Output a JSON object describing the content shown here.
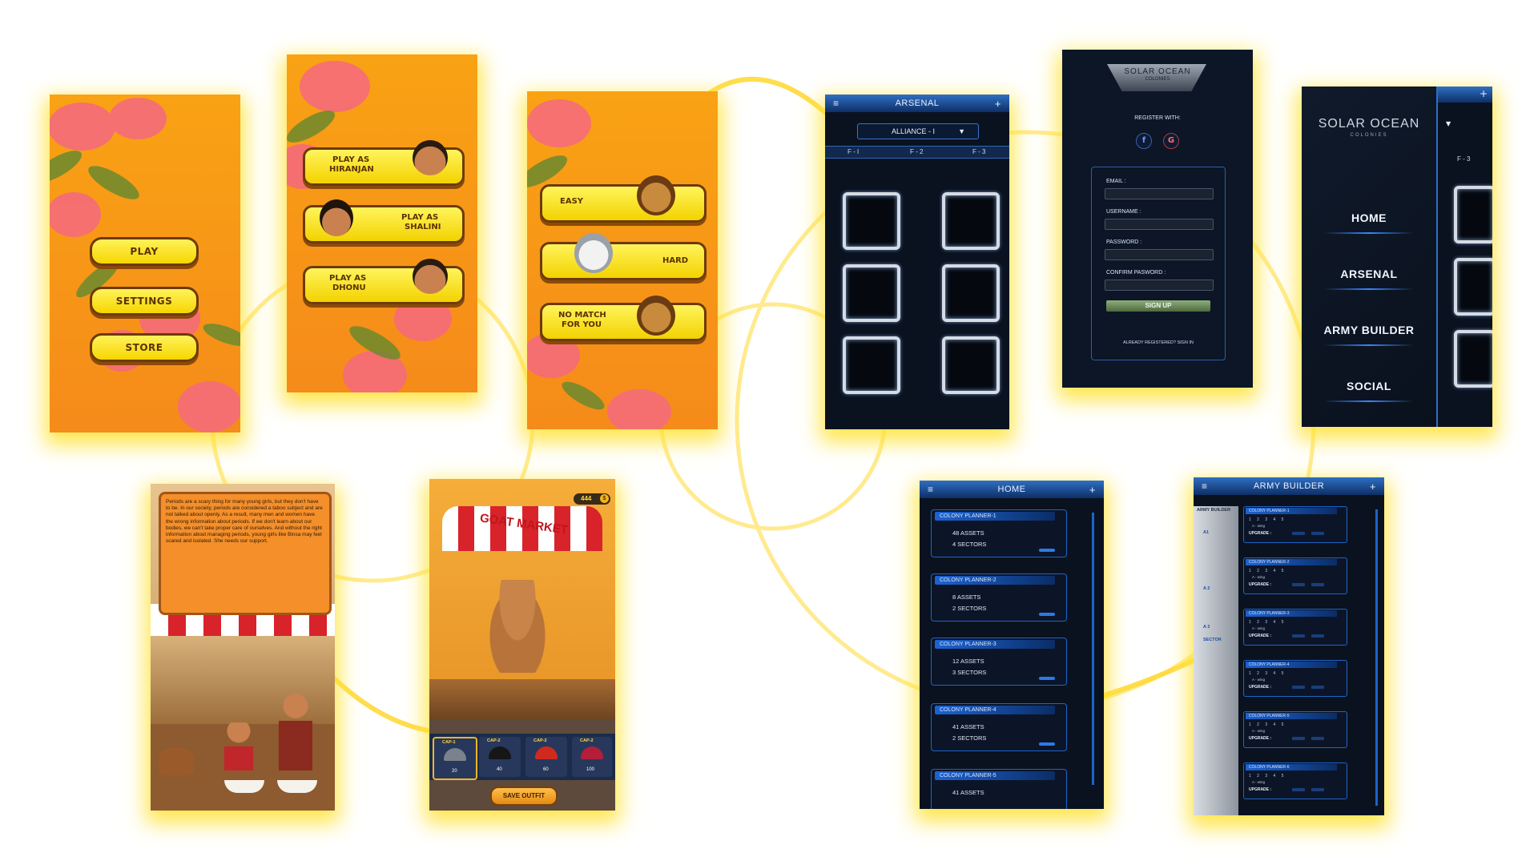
{
  "colors": {
    "accent_yellow": "#ffe230",
    "orange_bg": "#f79a17",
    "dark_bg": "#0a1220",
    "blue_bar": "#1f5fc0"
  },
  "screen_a": {
    "buttons": [
      {
        "label": "PLAY"
      },
      {
        "label": "SETTINGS"
      },
      {
        "label": "STORE"
      }
    ]
  },
  "screen_b": {
    "players": [
      {
        "line1": "PLAY AS",
        "line2": "HIRANJAN"
      },
      {
        "line1": "PLAY AS",
        "line2": "SHALINI"
      },
      {
        "line1": "PLAY AS",
        "line2": "DHONU"
      }
    ]
  },
  "screen_c": {
    "options": [
      {
        "line1": "EASY",
        "line2": ""
      },
      {
        "line1": "HARD",
        "line2": ""
      },
      {
        "line1": "NO MATCH",
        "line2": "FOR YOU"
      }
    ]
  },
  "arsenal": {
    "title": "ARSENAL",
    "menu_icon": "hamburger-icon",
    "add_icon": "plus-icon",
    "dropdown": "ALLIANCE - I",
    "tabs": [
      "F - I",
      "F - 2",
      "F - 3"
    ]
  },
  "register": {
    "logo_text": "SOLAR OCEAN",
    "logo_sub": "COLONIES",
    "register_with": "REGISTER WITH:",
    "facebook": "f",
    "google": "G",
    "email_label": "EMAIL :",
    "username_label": "USERNAME :",
    "password_label": "PASSWORD :",
    "confirm_label": "CONFIRM PASWORD :",
    "signup": "SIGN UP",
    "signin": "ALREADY REGISTERED? SIGN IN"
  },
  "menu_screen": {
    "logo_text": "SOLAR OCEAN",
    "logo_sub": "COLONIES",
    "items": [
      "HOME",
      "ARSENAL",
      "ARMY BUILDER",
      "SOCIAL"
    ],
    "peek_tab": "F - 3"
  },
  "story": {
    "text": "Periods are a scary thing for many young girls, but they don't have to be. In our society, periods are considered a taboo subject and are not talked about openly. As a result, many men and women have the wrong information about periods. If we don't learn about our bodies, we can't take proper care of ourselves. And without the right information about managing periods, young girls like Binsa may feel scared and isolated. She needs our support."
  },
  "market": {
    "coins": "444",
    "coin_symbol": "$",
    "sign": "GOAT MARKET",
    "caps": [
      {
        "name": "CAP-1",
        "price": "20"
      },
      {
        "name": "CAP-2",
        "price": "40"
      },
      {
        "name": "CAP-2",
        "price": "60"
      },
      {
        "name": "CAP-2",
        "price": "100"
      }
    ],
    "save": "SAVE OUTFIT"
  },
  "home": {
    "title": "HOME",
    "planners": [
      {
        "name": "COLONY PLANNER-1",
        "assets": "48 ASSETS",
        "sectors": "4 SECTORS"
      },
      {
        "name": "COLONY PLANNER-2",
        "assets": "8 ASSETS",
        "sectors": "2 SECTORS"
      },
      {
        "name": "COLONY PLANNER-3",
        "assets": "12 ASSETS",
        "sectors": "3 SECTORS"
      },
      {
        "name": "COLONY PLANNER-4",
        "assets": "41 ASSETS",
        "sectors": "2 SECTORS"
      },
      {
        "name": "COLONY PLANNER-5",
        "assets": "41 ASSETS",
        "sectors": ""
      }
    ]
  },
  "army": {
    "title": "ARMY BUILDER",
    "side_title": "ARMY BUILDER",
    "side_items": [
      "A1",
      "A 2",
      "A 3",
      "SECTOR"
    ],
    "rows": [
      "COLONY PLANNER-1",
      "COLONY PLANNER-2",
      "COLONY PLANNER-3",
      "COLONY PLANNER-4",
      "COLONY PLANNER-5",
      "COLONY PLANNER-6"
    ],
    "digits": "1 2 3 4 5",
    "wing": "A - wing",
    "upgrade": "UPGRADE :"
  }
}
